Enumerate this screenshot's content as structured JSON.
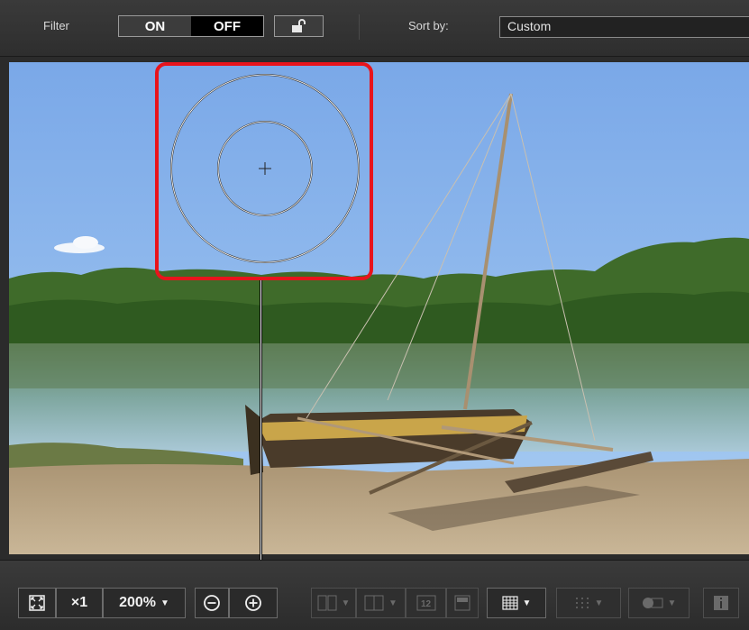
{
  "filter_bar": {
    "filter_label": "Filter",
    "on_label": "ON",
    "off_label": "OFF",
    "sort_label": "Sort by:",
    "sort_value": "Custom"
  },
  "toolbar": {
    "fullscreen_icon": "fullscreen-icon",
    "zoom_1x_label": "×1",
    "zoom_value": "200%",
    "zoom_out_icon": "minus-circle-icon",
    "zoom_in_icon": "plus-circle-icon",
    "grid_icon": "grid-icon",
    "info_icon": "info-icon"
  },
  "viewer": {
    "focus_marker": "circular-focus-point",
    "callout_color": "#e8141c"
  }
}
